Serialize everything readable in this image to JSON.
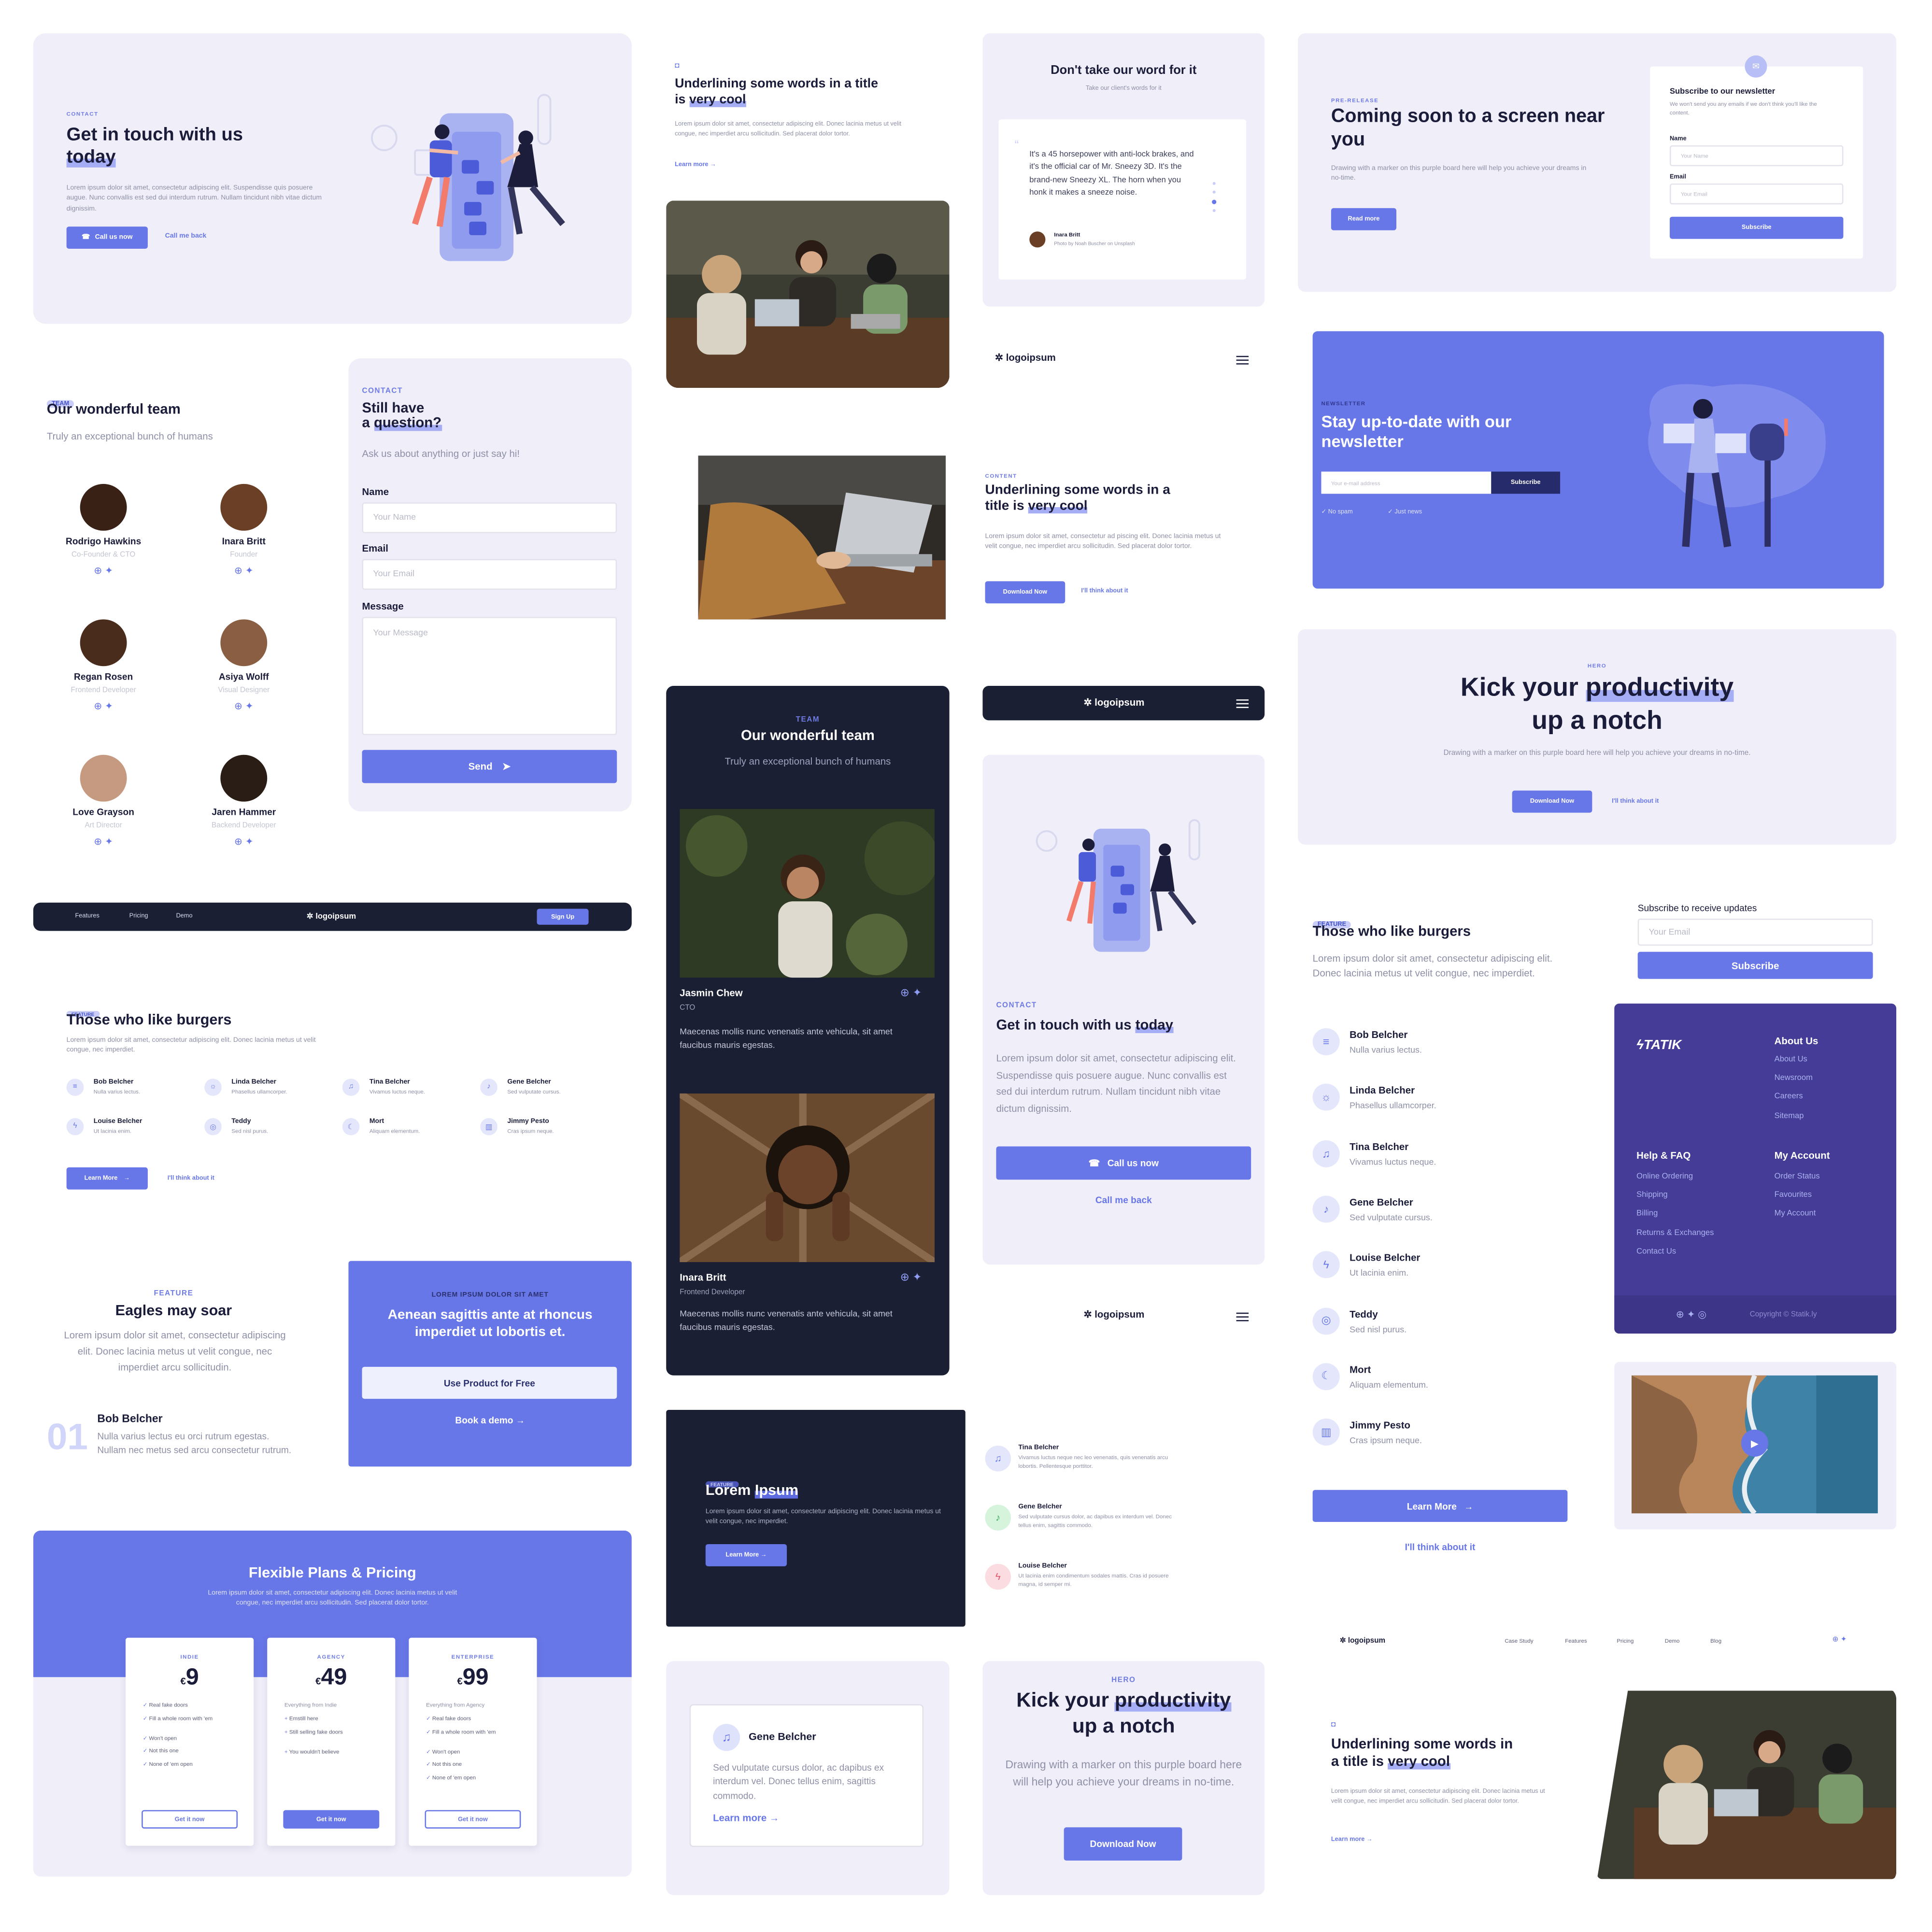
{
  "colors": {
    "accent": "#6877e7",
    "dark": "#1a1f33",
    "lavender": "#f0eef8",
    "footer": "#443c96"
  },
  "contact_hero": {
    "kicker": "CONTACT",
    "title_a": "Get in touch with us",
    "title_b": "today",
    "body": "Lorem ipsum dolor sit amet, consectetur adipiscing elit. Suspendisse quis posuere augue. Nunc convallis est sed dui interdum rutrum. Nullam tincidunt nibh vitae dictum dignissim.",
    "call_btn": "Call us now",
    "callback_link": "Call me back"
  },
  "team_light": {
    "pill": "TEAM",
    "title": "Our wonderful team",
    "subtitle": "Truly an exceptional bunch of humans",
    "members": [
      {
        "name": "Rodrigo Hawkins",
        "role": "Co-Founder & CTO"
      },
      {
        "name": "Inara Britt",
        "role": "Founder"
      },
      {
        "name": "Regan Rosen",
        "role": "Frontend Developer"
      },
      {
        "name": "Asiya Wolff",
        "role": "Visual Designer"
      },
      {
        "name": "Love Grayson",
        "role": "Art Director"
      },
      {
        "name": "Jaren Hammer",
        "role": "Backend Developer"
      }
    ]
  },
  "contact_form": {
    "kicker": "CONTACT",
    "title_a": "Still have",
    "title_b_pre": "a ",
    "title_b": "question?",
    "subtitle": "Ask us about anything or just say hi!",
    "name_label": "Name",
    "name_ph": "Your Name",
    "email_label": "Email",
    "email_ph": "Your Email",
    "message_label": "Message",
    "message_ph": "Your Message",
    "send": "Send"
  },
  "navbar": {
    "links": [
      "Features",
      "Pricing",
      "Demo"
    ],
    "logo": "logoipsum",
    "signup": "Sign Up"
  },
  "features_grid": {
    "pill": "FEATURE",
    "title": "Those who like burgers",
    "body": "Lorem ipsum dolor sit amet, consectetur adipiscing elit. Donec lacinia metus ut velit congue, nec imperdiet.",
    "items": [
      {
        "name": "Bob Belcher",
        "desc": "Nulla varius lectus."
      },
      {
        "name": "Linda Belcher",
        "desc": "Phasellus ullamcorper."
      },
      {
        "name": "Tina Belcher",
        "desc": "Vivamus luctus neque."
      },
      {
        "name": "Gene Belcher",
        "desc": "Sed vulputate cursus."
      },
      {
        "name": "Louise Belcher",
        "desc": "Ut lacinia enim."
      },
      {
        "name": "Teddy",
        "desc": "Sed nisl purus."
      },
      {
        "name": "Mort",
        "desc": "Aliquam elementum."
      },
      {
        "name": "Jimmy Pesto",
        "desc": "Cras ipsum neque."
      }
    ],
    "learn": "Learn More",
    "think": "I'll think about it"
  },
  "eagles": {
    "kicker": "FEATURE",
    "title": "Eagles may soar",
    "body": "Lorem ipsum dolor sit amet, consectetur adipiscing elit. Donec lacinia metus ut velit congue, nec imperdiet arcu sollicitudin.",
    "num": "01",
    "item_title": "Bob Belcher",
    "item_body": "Nulla varius lectus eu orci rutrum egestas. Nullam nec metus sed arcu consectetur rutrum."
  },
  "cta_blue": {
    "kicker": "LOREM IPSUM DOLOR SIT AMET",
    "title": "Aenean sagittis ante at rhoncus imperdiet ut lobortis et.",
    "btn": "Use Product for Free",
    "demo": "Book a demo"
  },
  "pricing": {
    "title": "Flexible Plans & Pricing",
    "body": "Lorem ipsum dolor sit amet, consectetur adipiscing elit. Donec lacinia metus ut velit congue, nec imperdiet arcu sollicitudin. Sed placerat dolor tortor.",
    "plans": [
      {
        "kicker": "INDIE",
        "price": "9",
        "sub": "",
        "features": [
          "Real fake doors",
          "Fill a whole room with 'em",
          "Won't open",
          "Not this one",
          "None of 'em open"
        ],
        "btn": "Get it now"
      },
      {
        "kicker": "AGENCY",
        "price": "49",
        "sub": "Everything from Indie",
        "features": [
          "Emstill here",
          "Still selling fake doors",
          "You wouldn't believe"
        ],
        "btn": "Get it now"
      },
      {
        "kicker": "ENTERPRISE",
        "price": "99",
        "sub": "Everything from Agency",
        "features": [
          "Real fake doors",
          "Fill a whole room with 'em",
          "Won't open",
          "Not this one",
          "None of 'em open"
        ],
        "btn": "Get it now"
      }
    ],
    "currency": "€"
  },
  "underline_top": {
    "title_a": "Underlining some words in a title",
    "title_b_pre": "is ",
    "title_b": "very cool",
    "body": "Lorem ipsum dolor sit amet, consectetur adipiscing elit. Donec lacinia metus ut velit congue, nec imperdiet arcu sollicitudin. Sed placerat dolor tortor.",
    "learn": "Learn more →"
  },
  "team_dark": {
    "kicker": "TEAM",
    "title": "Our wonderful team",
    "subtitle": "Truly an exceptional bunch of humans",
    "members": [
      {
        "name": "Jasmin Chew",
        "role": "CTO",
        "body": "Maecenas mollis nunc venenatis ante vehicula, sit amet faucibus mauris egestas."
      },
      {
        "name": "Inara Britt",
        "role": "Frontend Developer",
        "body": "Maecenas mollis nunc venenatis ante vehicula, sit amet faucibus mauris egestas."
      }
    ]
  },
  "lorem_dark": {
    "pill": "FEATURE",
    "title_pre": "Lorem ",
    "title_hl": "Ipsum",
    "body": "Lorem ipsum dolor sit amet, consectetur adipiscing elit. Donec lacinia metus ut velit congue, nec imperdiet.",
    "learn": "Learn More →"
  },
  "gene_card": {
    "name": "Gene Belcher",
    "body": "Sed vulputate cursus dolor, ac dapibus ex interdum vel. Donec tellus enim, sagittis commodo.",
    "learn": "Learn more"
  },
  "testimonial": {
    "title": "Don't take our word for it",
    "subtitle": "Take our client's words for it",
    "quote": "It's a 45 horsepower with anti-lock brakes, and it's the official car of Mr. Sneezy 3D. It's the brand-new Sneezy XL. The horn when you honk it makes a sneeze noise.",
    "author": "Inara Britt",
    "credit": "Photo by Noah Buscher on Unsplash"
  },
  "logo_white": {
    "logo": "logoipsum"
  },
  "underline_mid": {
    "kicker": "CONTENT",
    "title_a": "Underlining some words in a",
    "title_b_pre": "title is ",
    "title_b": "very cool",
    "body": "Lorem ipsum dolor sit amet, consectetur ad piscing elit. Donec lacinia metus ut velit congue, nec imperdiet arcu sollicitudin. Sed placerat dolor tortor.",
    "btn": "Download Now",
    "think": "I'll think about it"
  },
  "logo_dark": {
    "logo": "logoipsum"
  },
  "contact_mobile": {
    "kicker": "CONTACT",
    "title_a": "Get in touch with us ",
    "title_b": "today",
    "body": "Lorem ipsum dolor sit amet, consectetur adipiscing elit. Suspendisse quis posuere augue. Nunc convallis est sed dui interdum rutrum. Nullam tincidunt nibh vitae dictum dignissim.",
    "call_btn": "Call us now",
    "callback": "Call me back"
  },
  "logo_white2": {
    "logo": "logoipsum"
  },
  "list_small": {
    "items": [
      {
        "name": "Tina Belcher",
        "desc": "Vivamus luctus neque nec leo venenatis, quis venenatis arcu lobortis. Pellentesque porttitor."
      },
      {
        "name": "Gene Belcher",
        "desc": "Sed vulputate cursus dolor, ac dapibus ex interdum vel. Donec tellus enim, sagittis commodo."
      },
      {
        "name": "Louise Belcher",
        "desc": "Ut lacinia enim condimentum sodales mattis. Cras id posuere magna, id semper mi."
      }
    ]
  },
  "hero_mobile": {
    "kicker": "HERO",
    "title_a": "Kick your ",
    "title_hl": "productivity",
    "title_b": "up a notch",
    "body": "Drawing with a marker on this purple board here will help you achieve your dreams in no-time.",
    "btn": "Download Now"
  },
  "coming_soon": {
    "kicker": "PRE-RELEASE",
    "title": "Coming soon to a screen near you",
    "body": "Drawing with a marker on this purple board here will help you achieve your dreams in no-time.",
    "btn": "Read more",
    "form_title": "Subscribe to our newsletter",
    "form_sub": "We won't send you any emails if we don't think you'll like the content.",
    "name_label": "Name",
    "name_ph": "Your Name",
    "email_label": "Email",
    "email_ph": "Your Email",
    "subscribe": "Subscribe"
  },
  "newsletter": {
    "kicker": "NEWSLETTER",
    "title": "Stay up-to-date with our newsletter",
    "input_ph": "Your e-mail address",
    "btn": "Subscribe",
    "check1": "No spam",
    "check2": "Just news"
  },
  "hero_wide": {
    "kicker": "HERO",
    "title_a": "Kick your ",
    "title_hl": "productivity",
    "title_b": "up a notch",
    "body": "Drawing with a marker on this purple board here will help you achieve your dreams in no-time.",
    "btn": "Download Now",
    "think": "I'll think about it"
  },
  "features_list": {
    "pill": "FEATURE",
    "title": "Those who like burgers",
    "body": "Lorem ipsum dolor sit amet, consectetur adipiscing elit. Donec lacinia metus ut velit congue, nec imperdiet.",
    "items": [
      {
        "name": "Bob Belcher",
        "desc": "Nulla varius lectus."
      },
      {
        "name": "Linda Belcher",
        "desc": "Phasellus ullamcorper."
      },
      {
        "name": "Tina Belcher",
        "desc": "Vivamus luctus neque."
      },
      {
        "name": "Gene Belcher",
        "desc": "Sed vulputate cursus."
      },
      {
        "name": "Louise Belcher",
        "desc": "Ut lacinia enim."
      },
      {
        "name": "Teddy",
        "desc": "Sed nisl purus."
      },
      {
        "name": "Mort",
        "desc": "Aliquam elementum."
      },
      {
        "name": "Jimmy Pesto",
        "desc": "Cras ipsum neque."
      }
    ],
    "learn": "Learn More",
    "think": "I'll think about it"
  },
  "subscribe_small": {
    "label": "Subscribe to receive updates",
    "ph": "Your Email",
    "btn": "Subscribe"
  },
  "footer": {
    "logo": "TATIK",
    "col1_title": "About Us",
    "col1": [
      "About Us",
      "Newsroom",
      "Careers",
      "Sitemap"
    ],
    "col2_title": "Help & FAQ",
    "col2": [
      "Online Ordering",
      "Shipping",
      "Billing",
      "Returns & Exchanges",
      "Contact Us"
    ],
    "col3_title": "My Account",
    "col3": [
      "Order Status",
      "Favourites",
      "My Account"
    ],
    "copyright": "Copyright © Statik.ly"
  },
  "nav_bottom": {
    "logo": "logoipsum",
    "links": [
      "Case Study",
      "Features",
      "Pricing",
      "Demo",
      "Blog"
    ]
  },
  "underline_bottom": {
    "title_a": "Underlining some words in",
    "title_b_pre": "a title is ",
    "title_b": "very cool",
    "body": "Lorem ipsum dolor sit amet, consectetur adipiscing elit. Donec lacinia metus ut velit congue, nec imperdiet arcu sollicitudin. Sed placerat dolor tortor.",
    "learn": "Learn more →"
  }
}
